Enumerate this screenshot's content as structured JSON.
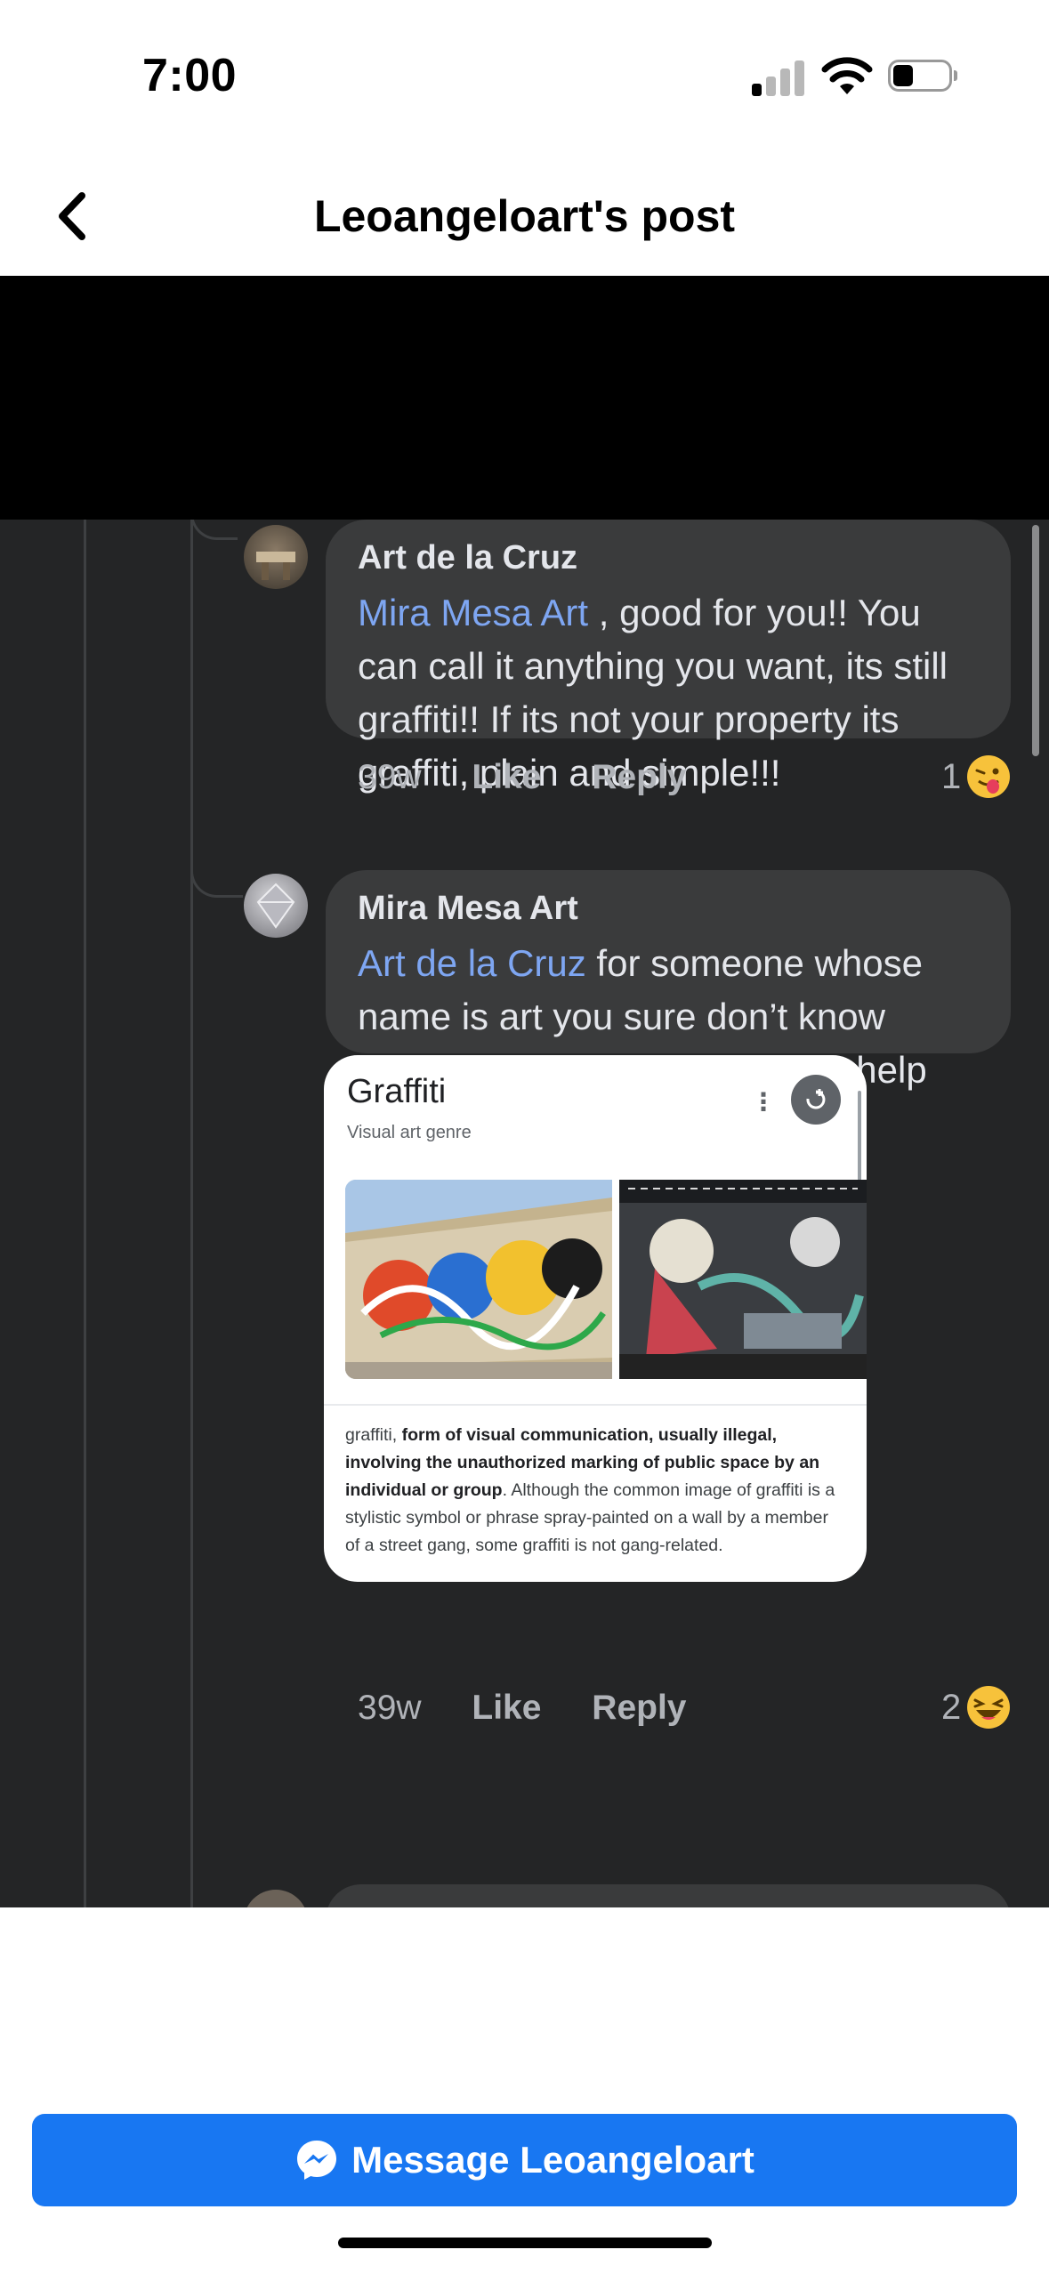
{
  "status_bar": {
    "time": "7:00"
  },
  "header": {
    "title": "Leoangeloart's post"
  },
  "comments": [
    {
      "author": "Art de la Cruz",
      "mention": "Mira Mesa Art",
      "text": " , good for you!! You can call it anything you want, its still graffiti!! If its not your property its graffiti, plain and simple!!!",
      "time": "39w",
      "like": "Like",
      "reply": "Reply",
      "reaction_count": "1",
      "reaction_icon": "tongue-wink-emoji-icon"
    },
    {
      "author": "Mira Mesa Art",
      "mention": "Art de la Cruz",
      "text": " for someone whose name is art you sure don’t know much about it.  So here let me help you.",
      "time": "39w",
      "like": "Like",
      "reply": "Reply",
      "reaction_count": "2",
      "reaction_icon": "laughing-emoji-icon"
    }
  ],
  "attachment": {
    "title": "Graffiti",
    "subtitle": "Visual art genre",
    "description_lead": "graffiti, ",
    "description_bold": "form of visual communication, usually illegal, involving the unauthorized marking of public space by an individual or group",
    "description_rest": ". Although the common image of graffiti is a stylistic symbol or phrase spray-painted on a wall by a member of a street gang, some graffiti is not gang-related."
  },
  "message_button": {
    "label": "Message Leoangeloart",
    "icon": "messenger-icon"
  },
  "colors": {
    "accent": "#1877f2",
    "mention": "#7ea6f2",
    "comment_bg": "#242526",
    "bubble": "#3a3b3c"
  }
}
